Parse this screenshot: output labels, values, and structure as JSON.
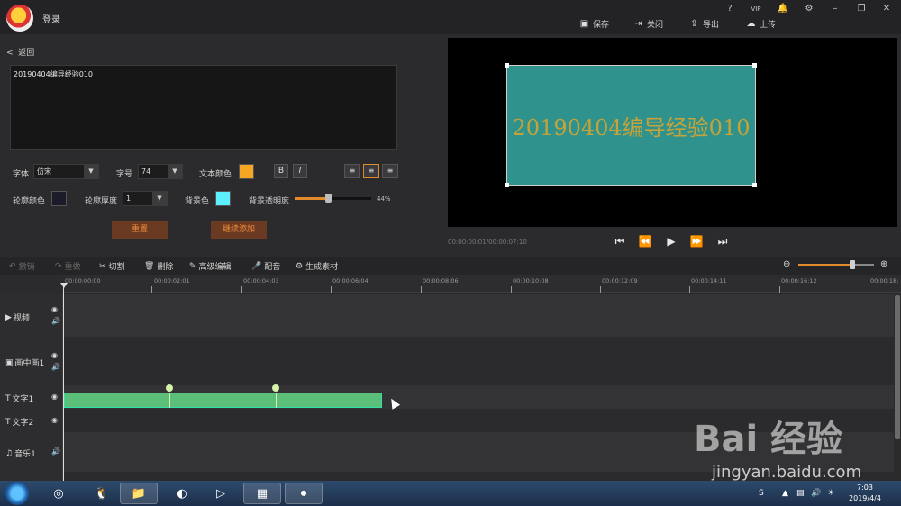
{
  "titlebar": {
    "login": "登录",
    "actions": {
      "save": "保存",
      "close": "关闭",
      "export": "导出",
      "upload": "上传"
    },
    "vip": "VIP"
  },
  "editor": {
    "back": "返回",
    "text_value": "20190404编导经验010",
    "font_label": "字体",
    "font_value": "仿宋",
    "size_label": "字号",
    "size_value": "74",
    "text_color_label": "文本颜色",
    "text_color": "#f5a623",
    "bold": "B",
    "italic": "I",
    "outline_color_label": "轮廓颜色",
    "outline_color": "#1b1b29",
    "outline_width_label": "轮廓厚度",
    "outline_width_value": "1",
    "bg_color_label": "背景色",
    "bg_color": "#5ef0ff",
    "bg_opacity_label": "背景透明度",
    "bg_opacity_value": "44%",
    "bg_opacity": 0.44,
    "reset_button": "重置",
    "continue_button": "继续添加"
  },
  "preview": {
    "caption": "20190404编导经验010",
    "clip_color": "#2f928c",
    "text_color": "#c5a33a",
    "timecode": "00:00:00:01/00:00:07:10"
  },
  "toolbar": {
    "undo": "撤销",
    "redo": "重做",
    "cut": "切割",
    "delete": "删除",
    "advanced_edit": "高级编辑",
    "dub": "配音",
    "generate": "生成素材"
  },
  "ruler": [
    "00:00:00:00",
    "00:00:02:01",
    "00:00:04:03",
    "00:00:06:04",
    "00:00:08:06",
    "00:00:10:08",
    "00:00:12:09",
    "00:00:14:11",
    "00:00:16:12",
    "00:00:18:"
  ],
  "tracks": {
    "video": "视频",
    "pip": "画中画1",
    "text1": "文字1",
    "text2": "文字2",
    "music": "音乐1"
  },
  "taskbar": {
    "time": "7:03",
    "date": "2019/4/4"
  },
  "watermark": {
    "logo": "Bai 经验",
    "url": "jingyan.baidu.com"
  }
}
